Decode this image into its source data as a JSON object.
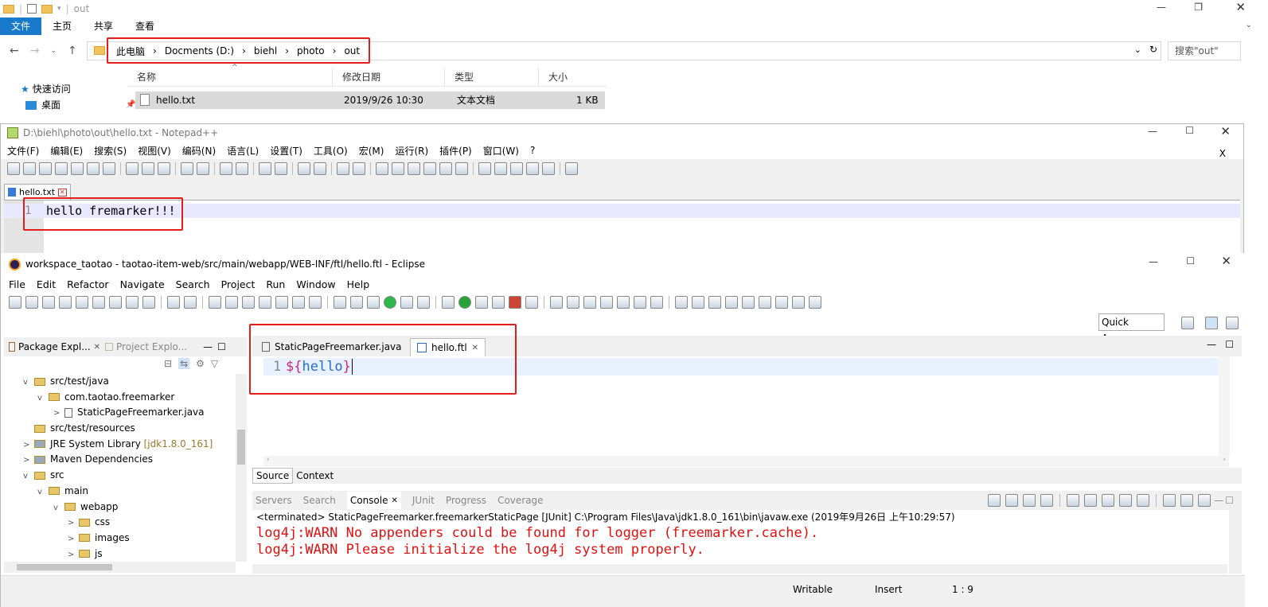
{
  "explorer": {
    "title": "out",
    "ribbon_tabs": [
      "文件",
      "主页",
      "共享",
      "查看"
    ],
    "breadcrumb": [
      "此电脑",
      "Docments (D:)",
      "biehl",
      "photo",
      "out"
    ],
    "search_placeholder": "搜索\"out\"",
    "columns": [
      "名称",
      "修改日期",
      "类型",
      "大小"
    ],
    "file": {
      "name": "hello.txt",
      "date": "2019/9/26 10:30",
      "type": "文本文档",
      "size": "1 KB"
    },
    "sidebar": [
      "快速访问",
      "桌面"
    ],
    "accent_color": "#1979ca"
  },
  "notepad": {
    "title": "D:\\biehl\\photo\\out\\hello.txt - Notepad++",
    "menu": [
      "文件(F)",
      "编辑(E)",
      "搜索(S)",
      "视图(V)",
      "编码(N)",
      "语言(L)",
      "设置(T)",
      "工具(O)",
      "宏(M)",
      "运行(R)",
      "插件(P)",
      "窗口(W)",
      "?"
    ],
    "close_x": "X",
    "tab": "hello.txt",
    "line_number": "1",
    "line_text": "hello fremarker!!!"
  },
  "eclipse": {
    "title": "workspace_taotao - taotao-item-web/src/main/webapp/WEB-INF/ftl/hello.ftl - Eclipse",
    "menu": [
      "File",
      "Edit",
      "Refactor",
      "Navigate",
      "Search",
      "Project",
      "Run",
      "Window",
      "Help"
    ],
    "quick_access": "Quick Access",
    "left_tabs": [
      "Package Expl...",
      "Project Explo..."
    ],
    "tree": [
      {
        "indent": 1,
        "label": "src/test/java",
        "chev": "v"
      },
      {
        "indent": 2,
        "label": "com.taotao.freemarker",
        "chev": "v"
      },
      {
        "indent": 3,
        "label": "StaticPageFreemarker.java",
        "chev": ">"
      },
      {
        "indent": 1,
        "label": "src/test/resources",
        "chev": ""
      },
      {
        "indent": 1,
        "label": "JRE System Library",
        "extra": "[jdk1.8.0_161]",
        "chev": ">"
      },
      {
        "indent": 1,
        "label": "Maven Dependencies",
        "chev": ">"
      },
      {
        "indent": 1,
        "label": "src",
        "chev": "v"
      },
      {
        "indent": 2,
        "label": "main",
        "chev": "v"
      },
      {
        "indent": 3,
        "label": "webapp",
        "chev": "v"
      },
      {
        "indent": 4,
        "label": "css",
        "chev": ">"
      },
      {
        "indent": 4,
        "label": "images",
        "chev": ">"
      },
      {
        "indent": 4,
        "label": "js",
        "chev": ">"
      }
    ],
    "editor_tabs": [
      "StaticPageFreemarker.java",
      "hello.ftl"
    ],
    "editor_line": "1",
    "editor_code": "${hello}",
    "bottom_editor_tabs": [
      "Source",
      "Context"
    ],
    "console_tabs": [
      "Servers",
      "Search",
      "Console",
      "JUnit",
      "Progress",
      "Coverage"
    ],
    "console_header": "<terminated> StaticPageFreemarker.freemarkerStaticPage [JUnit] C:\\Program Files\\Java\\jdk1.8.0_161\\bin\\javaw.exe (2019年9月26日 上午10:29:57)",
    "console_lines": [
      "log4j:WARN No appenders could be found for logger (freemarker.cache).",
      "log4j:WARN Please initialize the log4j system properly."
    ],
    "status": [
      "Writable",
      "Insert",
      "1 : 9"
    ],
    "colors": {
      "code_keyword": "#d0247a",
      "code_var": "#2a6bc8",
      "error": "#dd1111"
    }
  }
}
